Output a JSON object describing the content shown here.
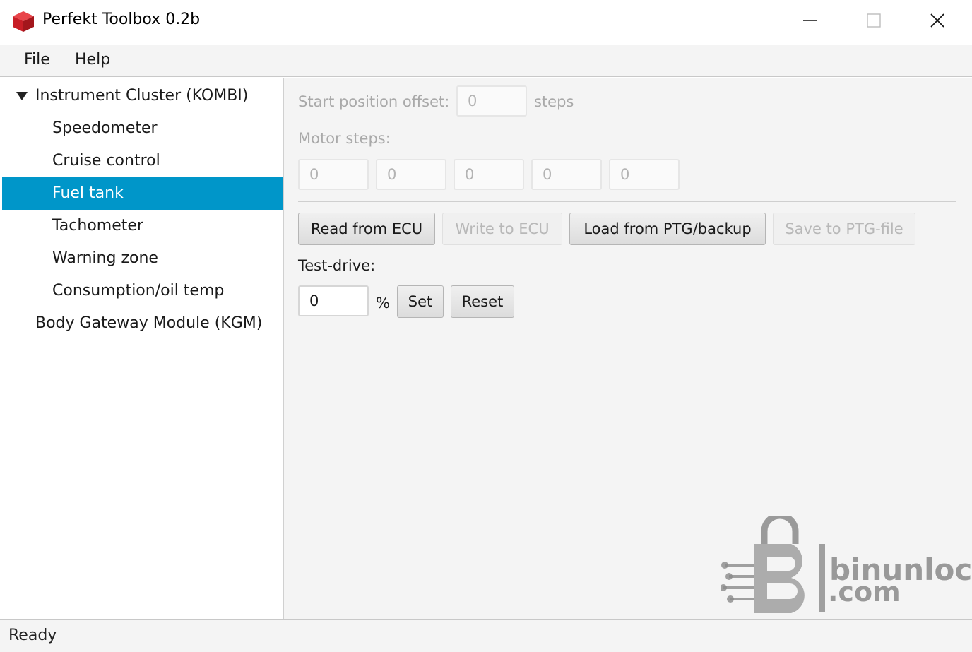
{
  "window": {
    "title": "Perfekt Toolbox 0.2b",
    "icon": "red-cube-icon",
    "controls": [
      "minimize-icon",
      "maximize-icon",
      "close-icon"
    ]
  },
  "menu": {
    "file": "File",
    "help": "Help"
  },
  "sidebar": {
    "group1": {
      "label": "Instrument Cluster (KOMBI)",
      "expanded": true,
      "items": [
        {
          "label": "Speedometer"
        },
        {
          "label": "Cruise control"
        },
        {
          "label": "Fuel tank",
          "selected": true
        },
        {
          "label": "Tachometer"
        },
        {
          "label": "Warning zone"
        },
        {
          "label": "Consumption/oil temp"
        }
      ]
    },
    "group2": {
      "label": "Body Gateway Module (KGM)"
    }
  },
  "main": {
    "start_offset": {
      "label": "Start position offset:",
      "value": "0",
      "unit": "steps",
      "enabled": false
    },
    "motor_steps": {
      "label": "Motor steps:",
      "values": [
        "0",
        "0",
        "0",
        "0",
        "0"
      ],
      "enabled": false
    },
    "buttons": {
      "read": {
        "label": "Read from ECU",
        "enabled": true
      },
      "write": {
        "label": "Write to ECU",
        "enabled": false
      },
      "load": {
        "label": "Load from PTG/backup",
        "enabled": true
      },
      "save": {
        "label": "Save to PTG-file",
        "enabled": false
      }
    },
    "test_drive": {
      "label": "Test-drive:",
      "value": "0",
      "unit": "%",
      "set": "Set",
      "reset": "Reset"
    }
  },
  "watermark": {
    "line1": "binunlock",
    "line2": ".com",
    "icon": "padlock-b-logo-icon"
  },
  "status": {
    "text": "Ready"
  },
  "colors": {
    "selection": "#0096c9",
    "app_icon": "#d9262c"
  }
}
